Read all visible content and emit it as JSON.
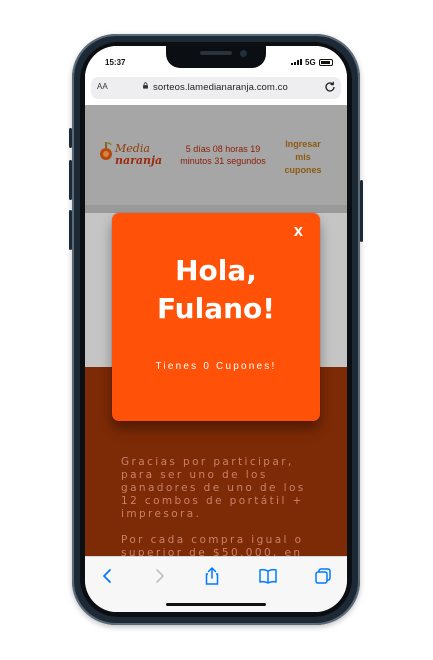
{
  "status_bar": {
    "time": "15:37",
    "network": "5G"
  },
  "browser": {
    "text_size_label": "AA",
    "url": "sorteos.lamedianaranja.com.co"
  },
  "site": {
    "logo_line1": "Media",
    "logo_line2": "naranja",
    "countdown": "5 días 08 horas 19 minutos 31 segundos",
    "login_link": "Ingresar mis cupones",
    "paragraph1": "Gracias por participar, para ser uno de los ganadores de uno de los 12 combos de portátil + impresora.",
    "paragraph2": "Por cada compra igual o superior de $50.000, en"
  },
  "modal": {
    "close_label": "X",
    "greeting_line1": "Hola,",
    "greeting_line2": "Fulano!",
    "coupons_text": "Tienes 0 Cupones!"
  },
  "colors": {
    "modal_bg": "#ff5208",
    "content_bg": "#7d2a06",
    "header_bg": "#a6a6a6",
    "accent_link": "#007aff"
  },
  "toolbar_icons": [
    "back-icon",
    "forward-icon",
    "share-icon",
    "bookmarks-icon",
    "tabs-icon"
  ]
}
